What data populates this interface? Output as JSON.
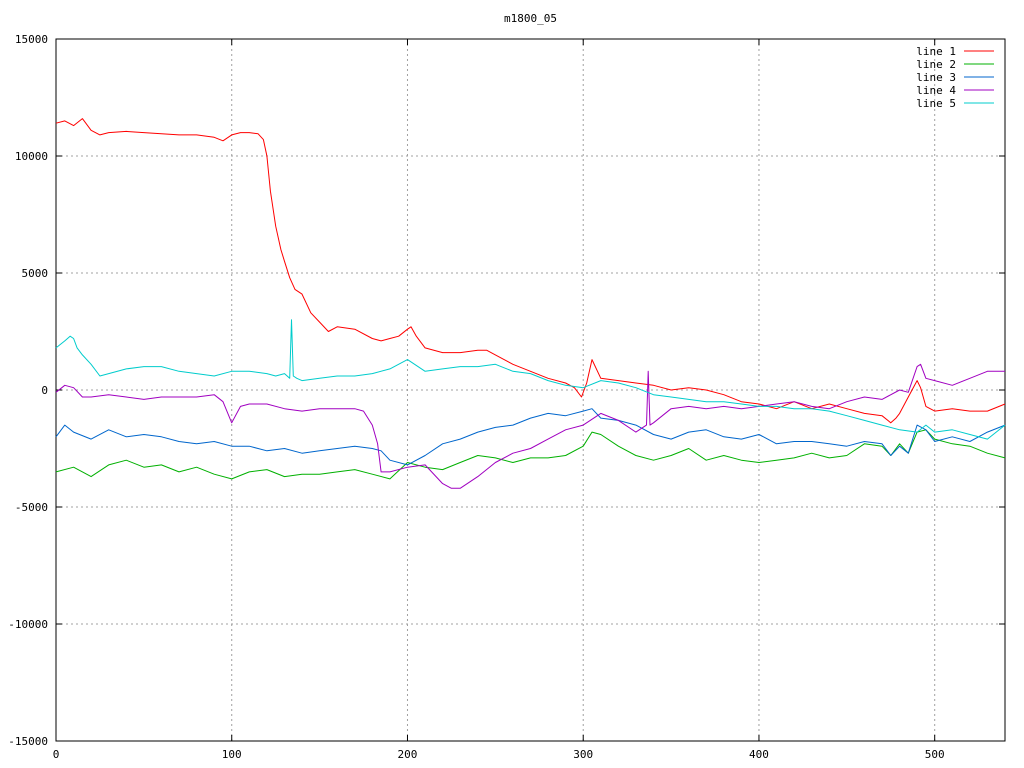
{
  "chart_data": {
    "type": "line",
    "title": "m1800_05",
    "xlabel": "",
    "ylabel": "",
    "xlim": [
      0,
      540
    ],
    "ylim": [
      -15000,
      15000
    ],
    "x_ticks": [
      0,
      100,
      200,
      300,
      400,
      500
    ],
    "y_ticks": [
      -15000,
      -10000,
      -5000,
      0,
      5000,
      10000,
      15000
    ],
    "grid": true,
    "legend_position": "top-right",
    "series": [
      {
        "name": "line 1",
        "color": "#ff0000",
        "x": [
          0,
          5,
          10,
          15,
          20,
          25,
          30,
          40,
          50,
          60,
          70,
          80,
          90,
          95,
          100,
          105,
          110,
          115,
          118,
          120,
          122,
          125,
          128,
          130,
          133,
          136,
          140,
          145,
          150,
          155,
          160,
          170,
          180,
          185,
          190,
          195,
          200,
          202,
          205,
          210,
          220,
          230,
          240,
          245,
          250,
          260,
          270,
          280,
          290,
          295,
          299,
          302,
          305,
          310,
          320,
          330,
          340,
          350,
          360,
          370,
          380,
          390,
          400,
          410,
          420,
          430,
          440,
          450,
          460,
          470,
          475,
          478,
          480,
          485,
          490,
          492,
          495,
          500,
          510,
          520,
          530,
          540
        ],
        "values": [
          11400,
          11500,
          11300,
          11600,
          11100,
          10900,
          11000,
          11050,
          11000,
          10950,
          10900,
          10900,
          10800,
          10650,
          10900,
          11000,
          11000,
          10950,
          10700,
          10000,
          8500,
          7000,
          6000,
          5500,
          4800,
          4300,
          4100,
          3300,
          2900,
          2500,
          2700,
          2600,
          2200,
          2100,
          2200,
          2300,
          2600,
          2700,
          2300,
          1800,
          1600,
          1600,
          1700,
          1700,
          1500,
          1100,
          800,
          500,
          300,
          100,
          -300,
          300,
          1300,
          500,
          400,
          300,
          200,
          0,
          100,
          0,
          -200,
          -500,
          -600,
          -800,
          -500,
          -800,
          -600,
          -800,
          -1000,
          -1100,
          -1400,
          -1200,
          -1000,
          -300,
          400,
          100,
          -700,
          -900,
          -800,
          -900,
          -900,
          -600
        ]
      },
      {
        "name": "line 2",
        "color": "#00b000",
        "x": [
          0,
          10,
          20,
          30,
          40,
          50,
          60,
          70,
          80,
          90,
          100,
          110,
          120,
          130,
          140,
          150,
          160,
          170,
          180,
          190,
          200,
          210,
          220,
          230,
          240,
          250,
          260,
          270,
          280,
          290,
          300,
          305,
          310,
          320,
          330,
          340,
          350,
          360,
          370,
          380,
          390,
          400,
          410,
          420,
          430,
          440,
          450,
          460,
          470,
          475,
          480,
          485,
          490,
          495,
          500,
          510,
          520,
          530,
          540
        ],
        "values": [
          -3500,
          -3300,
          -3700,
          -3200,
          -3000,
          -3300,
          -3200,
          -3500,
          -3300,
          -3600,
          -3800,
          -3500,
          -3400,
          -3700,
          -3600,
          -3600,
          -3500,
          -3400,
          -3600,
          -3800,
          -3100,
          -3300,
          -3400,
          -3100,
          -2800,
          -2900,
          -3100,
          -2900,
          -2900,
          -2800,
          -2400,
          -1800,
          -1900,
          -2400,
          -2800,
          -3000,
          -2800,
          -2500,
          -3000,
          -2800,
          -3000,
          -3100,
          -3000,
          -2900,
          -2700,
          -2900,
          -2800,
          -2300,
          -2400,
          -2800,
          -2300,
          -2700,
          -1800,
          -1700,
          -2100,
          -2300,
          -2400,
          -2700,
          -2900
        ]
      },
      {
        "name": "line 3",
        "color": "#0066cc",
        "x": [
          0,
          5,
          10,
          20,
          30,
          40,
          50,
          60,
          70,
          80,
          90,
          100,
          110,
          120,
          130,
          140,
          150,
          160,
          170,
          180,
          185,
          190,
          200,
          210,
          220,
          230,
          240,
          250,
          260,
          270,
          280,
          290,
          300,
          305,
          310,
          320,
          330,
          340,
          350,
          360,
          370,
          380,
          390,
          400,
          410,
          420,
          430,
          440,
          450,
          460,
          470,
          475,
          480,
          485,
          490,
          495,
          500,
          510,
          520,
          530,
          540
        ],
        "values": [
          -2000,
          -1500,
          -1800,
          -2100,
          -1700,
          -2000,
          -1900,
          -2000,
          -2200,
          -2300,
          -2200,
          -2400,
          -2400,
          -2600,
          -2500,
          -2700,
          -2600,
          -2500,
          -2400,
          -2500,
          -2600,
          -3000,
          -3200,
          -2800,
          -2300,
          -2100,
          -1800,
          -1600,
          -1500,
          -1200,
          -1000,
          -1100,
          -900,
          -800,
          -1200,
          -1300,
          -1500,
          -1900,
          -2100,
          -1800,
          -1700,
          -2000,
          -2100,
          -1900,
          -2300,
          -2200,
          -2200,
          -2300,
          -2400,
          -2200,
          -2300,
          -2800,
          -2400,
          -2700,
          -1500,
          -1700,
          -2200,
          -2000,
          -2200,
          -1800,
          -1500
        ]
      },
      {
        "name": "line 4",
        "color": "#a000c0",
        "x": [
          0,
          5,
          10,
          15,
          20,
          30,
          40,
          50,
          60,
          70,
          80,
          90,
          95,
          100,
          105,
          110,
          120,
          130,
          140,
          150,
          160,
          170,
          175,
          180,
          183,
          185,
          190,
          200,
          210,
          220,
          225,
          230,
          240,
          250,
          260,
          270,
          280,
          290,
          300,
          310,
          320,
          330,
          336,
          337,
          338,
          340,
          350,
          360,
          370,
          380,
          390,
          400,
          410,
          420,
          430,
          440,
          450,
          460,
          470,
          480,
          485,
          490,
          492,
          495,
          500,
          510,
          520,
          530,
          540
        ],
        "values": [
          -100,
          200,
          100,
          -300,
          -300,
          -200,
          -300,
          -400,
          -300,
          -300,
          -300,
          -200,
          -500,
          -1400,
          -700,
          -600,
          -600,
          -800,
          -900,
          -800,
          -800,
          -800,
          -900,
          -1500,
          -2300,
          -3500,
          -3500,
          -3300,
          -3200,
          -4000,
          -4200,
          -4200,
          -3700,
          -3100,
          -2700,
          -2500,
          -2100,
          -1700,
          -1500,
          -1000,
          -1300,
          -1800,
          -1500,
          800,
          -1500,
          -1400,
          -800,
          -700,
          -800,
          -700,
          -800,
          -700,
          -600,
          -500,
          -700,
          -800,
          -500,
          -300,
          -400,
          0,
          -100,
          1000,
          1100,
          500,
          400,
          200,
          500,
          800,
          800
        ]
      },
      {
        "name": "line 5",
        "color": "#00cccc",
        "x": [
          0,
          5,
          8,
          10,
          12,
          15,
          20,
          25,
          30,
          40,
          50,
          60,
          70,
          80,
          90,
          100,
          110,
          120,
          125,
          130,
          133,
          134,
          135,
          137,
          140,
          150,
          160,
          170,
          180,
          190,
          200,
          210,
          220,
          230,
          240,
          250,
          260,
          270,
          280,
          290,
          300,
          310,
          320,
          330,
          340,
          350,
          360,
          370,
          380,
          390,
          400,
          410,
          420,
          430,
          440,
          450,
          460,
          470,
          480,
          490,
          495,
          500,
          510,
          520,
          530,
          540
        ],
        "values": [
          1800,
          2100,
          2300,
          2200,
          1800,
          1500,
          1100,
          600,
          700,
          900,
          1000,
          1000,
          800,
          700,
          600,
          800,
          800,
          700,
          600,
          700,
          500,
          3000,
          600,
          500,
          400,
          500,
          600,
          600,
          700,
          900,
          1300,
          800,
          900,
          1000,
          1000,
          1100,
          800,
          700,
          400,
          200,
          100,
          400,
          300,
          100,
          -200,
          -300,
          -400,
          -500,
          -500,
          -600,
          -700,
          -700,
          -800,
          -800,
          -900,
          -1100,
          -1300,
          -1500,
          -1700,
          -1800,
          -1500,
          -1800,
          -1700,
          -1900,
          -2100,
          -1500
        ]
      }
    ]
  }
}
